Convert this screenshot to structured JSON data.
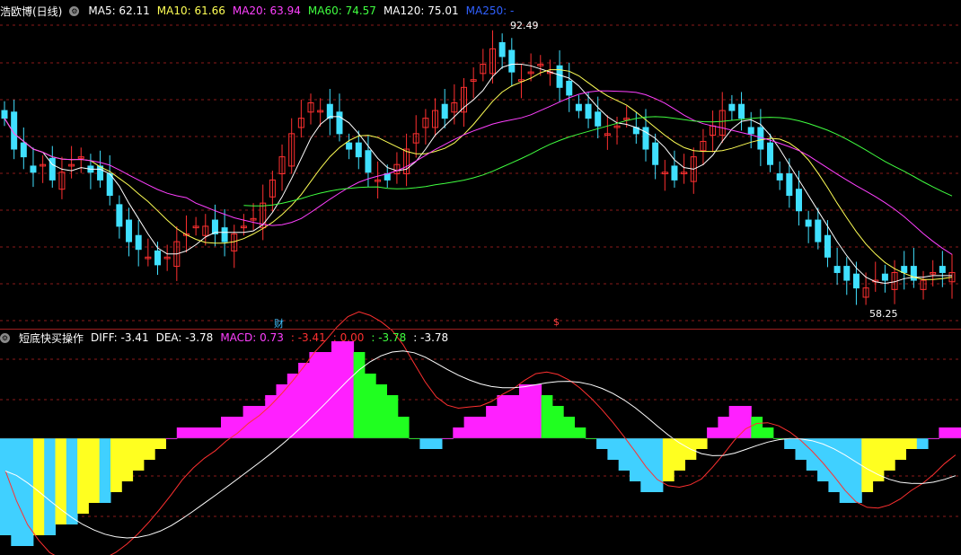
{
  "main": {
    "title": "浩欧博(日线)",
    "mas": [
      {
        "label": "MA5: 62.11",
        "color": "#ffffff"
      },
      {
        "label": "MA10: 61.66",
        "color": "#ffff55"
      },
      {
        "label": "MA20: 63.94",
        "color": "#ff40ff"
      },
      {
        "label": "MA60: 74.57",
        "color": "#40ff40"
      },
      {
        "label": "MA120: 75.01",
        "color": "#ffffff"
      },
      {
        "label": "MA250: -",
        "color": "#3060ff"
      }
    ],
    "high_label": "92.49",
    "low_label": "58.25",
    "marker_cai": "财",
    "marker_dollar": "$"
  },
  "sub": {
    "title": "短底快买操作",
    "diff": "DIFF: -3.41",
    "dea": "DEA: -3.78",
    "macd": "MACD: 0.73",
    "v1": ": -3.41",
    "v2": ": 0.00",
    "v3": ": -3.78",
    "v4": ": -3.78"
  },
  "colors": {
    "up": "#ff3030",
    "down": "#40e0ff",
    "grid": "#8b1a1a",
    "macd_pos": "#ff20ff",
    "macd_pos_fall": "#20ff20",
    "macd_neg": "#40d0ff",
    "macd_neg_rise": "#ffff20"
  },
  "chart_data": {
    "type": "candlestick",
    "price_range": [
      56,
      95
    ],
    "high": 92.49,
    "low": 58.25,
    "closes": [
      82,
      78,
      77,
      75,
      76,
      74,
      75,
      76,
      77,
      75,
      74,
      72,
      68,
      66,
      65,
      64,
      63,
      64,
      66,
      67,
      68,
      68,
      67,
      66,
      67,
      68,
      69,
      71,
      74,
      77,
      80,
      82,
      84,
      83,
      82,
      80,
      78,
      77,
      75,
      74,
      74,
      76,
      78,
      80,
      82,
      83,
      82,
      84,
      86,
      87,
      89,
      91,
      90,
      88,
      87,
      88,
      89,
      88,
      86,
      85,
      83,
      82,
      81,
      80,
      81,
      82,
      80,
      78,
      76,
      75,
      74,
      75,
      77,
      79,
      81,
      83,
      83,
      82,
      80,
      78,
      76,
      74,
      72,
      70,
      68,
      66,
      64,
      62,
      61,
      60,
      60,
      61,
      61,
      62,
      62,
      61,
      61,
      62,
      62,
      62
    ],
    "macd_hist": [
      -9,
      -10,
      -10,
      -9,
      -9,
      -8,
      -8,
      -7,
      -6,
      -6,
      -5,
      -4,
      -3,
      -2,
      -1,
      0,
      1,
      1,
      1,
      1,
      2,
      2,
      3,
      3,
      4,
      5,
      6,
      7,
      8,
      8,
      9,
      9,
      8,
      6,
      5,
      4,
      2,
      0,
      -1,
      -1,
      0,
      1,
      2,
      2,
      3,
      4,
      4,
      5,
      5,
      4,
      3,
      2,
      1,
      0,
      -1,
      -2,
      -3,
      -4,
      -5,
      -5,
      -4,
      -3,
      -2,
      -1,
      1,
      2,
      3,
      3,
      2,
      1,
      0,
      -1,
      -2,
      -3,
      -4,
      -5,
      -6,
      -6,
      -5,
      -4,
      -3,
      -2,
      -1,
      -1,
      0,
      1,
      1
    ]
  }
}
